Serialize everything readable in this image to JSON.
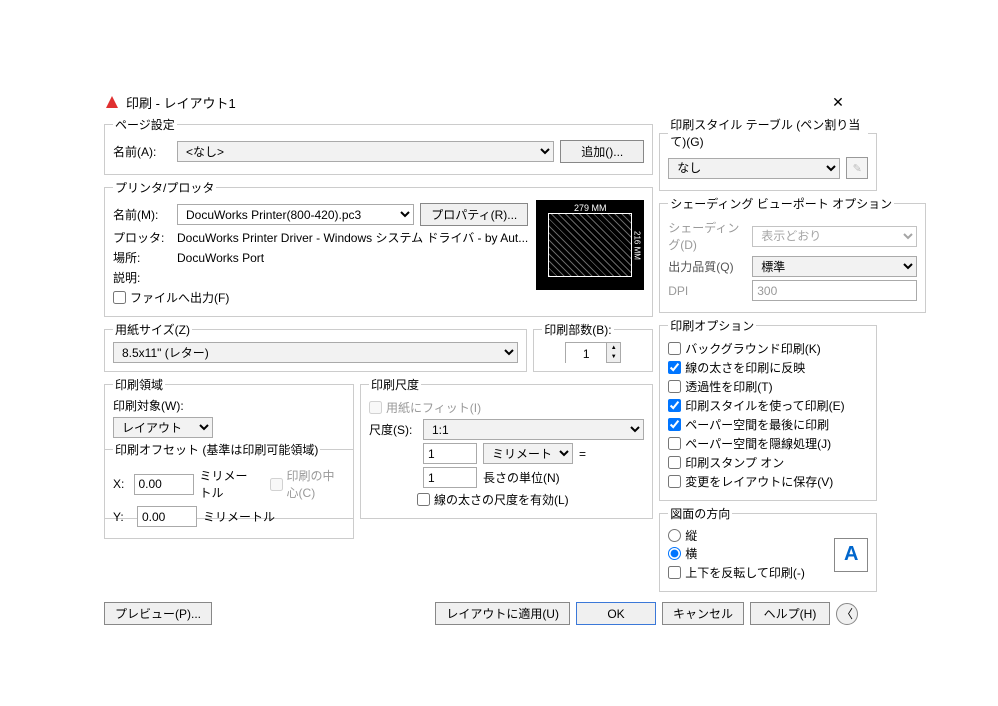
{
  "title": "印刷 - レイアウト1",
  "pageSetup": {
    "legend": "ページ設定",
    "nameLabel": "名前(A):",
    "name": "<なし>",
    "addBtn": "追加()..."
  },
  "printer": {
    "legend": "プリンタ/プロッタ",
    "nameLabel": "名前(M):",
    "name": "DocuWorks Printer(800-420).pc3",
    "propsBtn": "プロパティ(R)...",
    "plotterLabel": "プロッタ:",
    "plotter": "DocuWorks Printer Driver - Windows システム ドライバ - by Aut...",
    "locationLabel": "場所:",
    "location": "DocuWorks Port",
    "descLabel": "説明:",
    "fileOut": "ファイルへ出力(F)",
    "previewTop": "279 MM",
    "previewSide": "216 MM"
  },
  "paper": {
    "legend": "用紙サイズ(Z)",
    "size": "8.5x11\" (レター)"
  },
  "copies": {
    "legend": "印刷部数(B):",
    "value": "1"
  },
  "area": {
    "legend": "印刷領域",
    "whatLabel": "印刷対象(W):",
    "what": "レイアウト"
  },
  "scale": {
    "legend": "印刷尺度",
    "fit": "用紙にフィット(I)",
    "scaleLabel": "尺度(S):",
    "scale": "1:1",
    "unitVal": "1",
    "unit": "ミリメートル",
    "eq": "=",
    "drawVal": "1",
    "drawUnit": "長さの単位(N)",
    "scaleLine": "線の太さの尺度を有効(L)"
  },
  "offset": {
    "legend": "印刷オフセット (基準は印刷可能領域)",
    "xLabel": "X:",
    "x": "0.00",
    "yLabel": "Y:",
    "y": "0.00",
    "unit": "ミリメートル",
    "center": "印刷の中心(C)"
  },
  "style": {
    "legend": "印刷スタイル テーブル (ペン割り当て)(G)",
    "value": "なし"
  },
  "shade": {
    "legend": "シェーディング ビューポート オプション",
    "shadeLabel": "シェーディング(D)",
    "shade": "表示どおり",
    "qualityLabel": "出力品質(Q)",
    "quality": "標準",
    "dpiLabel": "DPI",
    "dpi": "300"
  },
  "options": {
    "legend": "印刷オプション",
    "bg": "バックグラウンド印刷(K)",
    "lw": "線の太さを印刷に反映",
    "trans": "透過性を印刷(T)",
    "styles": "印刷スタイルを使って印刷(E)",
    "paperlast": "ペーパー空間を最後に印刷",
    "hide": "ペーパー空間を隠線処理(J)",
    "stamp": "印刷スタンプ オン",
    "save": "変更をレイアウトに保存(V)"
  },
  "orient": {
    "legend": "図面の方向",
    "portrait": "縦",
    "landscape": "横",
    "upside": "上下を反転して印刷(-)"
  },
  "buttons": {
    "preview": "プレビュー(P)...",
    "apply": "レイアウトに適用(U)",
    "ok": "OK",
    "cancel": "キャンセル",
    "help": "ヘルプ(H)"
  }
}
